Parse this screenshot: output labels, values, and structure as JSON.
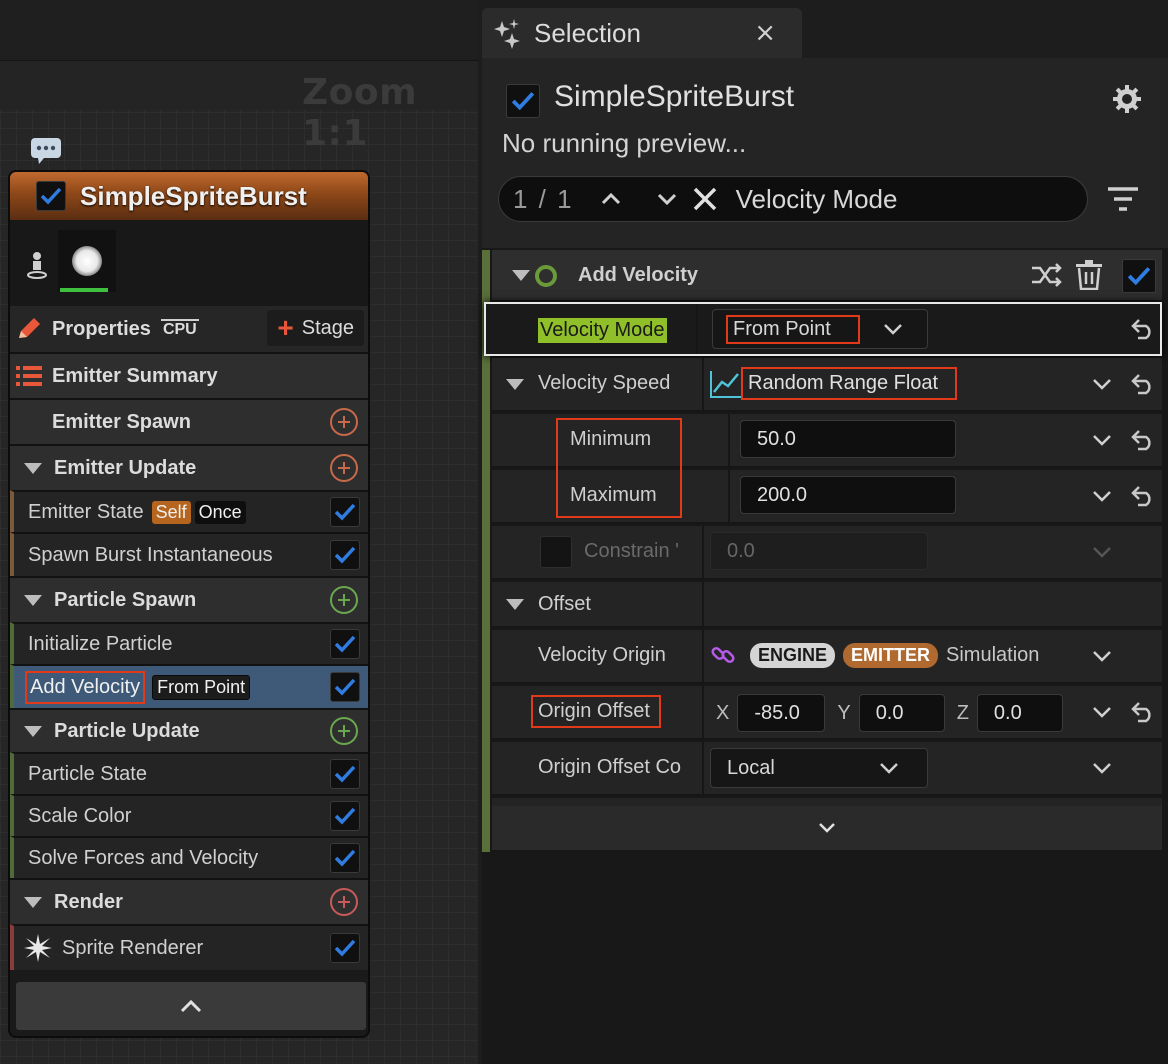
{
  "graph": {
    "zoom_label": "Zoom 1:1"
  },
  "emitter_node": {
    "title": "SimpleSpriteBurst",
    "toolbar": {
      "properties_label": "Properties",
      "cpu_label": "CPU",
      "stage_label": "Stage"
    },
    "sections": {
      "emitter_summary": "Emitter Summary",
      "emitter_spawn": "Emitter Spawn",
      "emitter_update": "Emitter Update",
      "particle_spawn": "Particle Spawn",
      "particle_update": "Particle Update",
      "render": "Render"
    },
    "modules": {
      "emitter_state": "Emitter State",
      "emitter_state_badges": [
        "Self",
        "Once"
      ],
      "spawn_burst": "Spawn Burst Instantaneous",
      "initialize_particle": "Initialize Particle",
      "add_velocity": "Add Velocity",
      "add_velocity_badge": "From Point",
      "particle_state": "Particle State",
      "scale_color": "Scale Color",
      "solve_forces": "Solve Forces and Velocity",
      "sprite_renderer": "Sprite Renderer"
    }
  },
  "selection_panel": {
    "tab_title": "Selection",
    "tab_close": "×",
    "emitter_name": "SimpleSpriteBurst",
    "status": "No running preview...",
    "search": {
      "count": "1 / 1",
      "query": "Velocity Mode"
    },
    "module_header": "Add Velocity",
    "properties": {
      "velocity_mode_label": "Velocity Mode",
      "velocity_mode_value": "From Point",
      "velocity_speed_label": "Velocity Speed",
      "velocity_speed_value": "Random Range Float",
      "minimum_label": "Minimum",
      "minimum_value": "50.0",
      "maximum_label": "Maximum",
      "maximum_value": "200.0",
      "constrain_label": "Constrain '",
      "constrain_value": "0.0",
      "offset_section": "Offset",
      "velocity_origin_label": "Velocity Origin",
      "velocity_origin_pills": [
        "ENGINE",
        "EMITTER"
      ],
      "velocity_origin_text": "Simulation",
      "origin_offset_label": "Origin Offset",
      "origin_offset_x_label": "X",
      "origin_offset_x": "-85.0",
      "origin_offset_y_label": "Y",
      "origin_offset_y": "0.0",
      "origin_offset_z_label": "Z",
      "origin_offset_z": "0.0",
      "origin_offset_co_label": "Origin Offset Co",
      "origin_offset_co_value": "Local"
    }
  },
  "colors": {
    "accent_blue": "#2f7de1",
    "highlight_green": "#8fbf29",
    "annotation_red": "#e13a1a",
    "emitter_orange": "#b5651d"
  }
}
